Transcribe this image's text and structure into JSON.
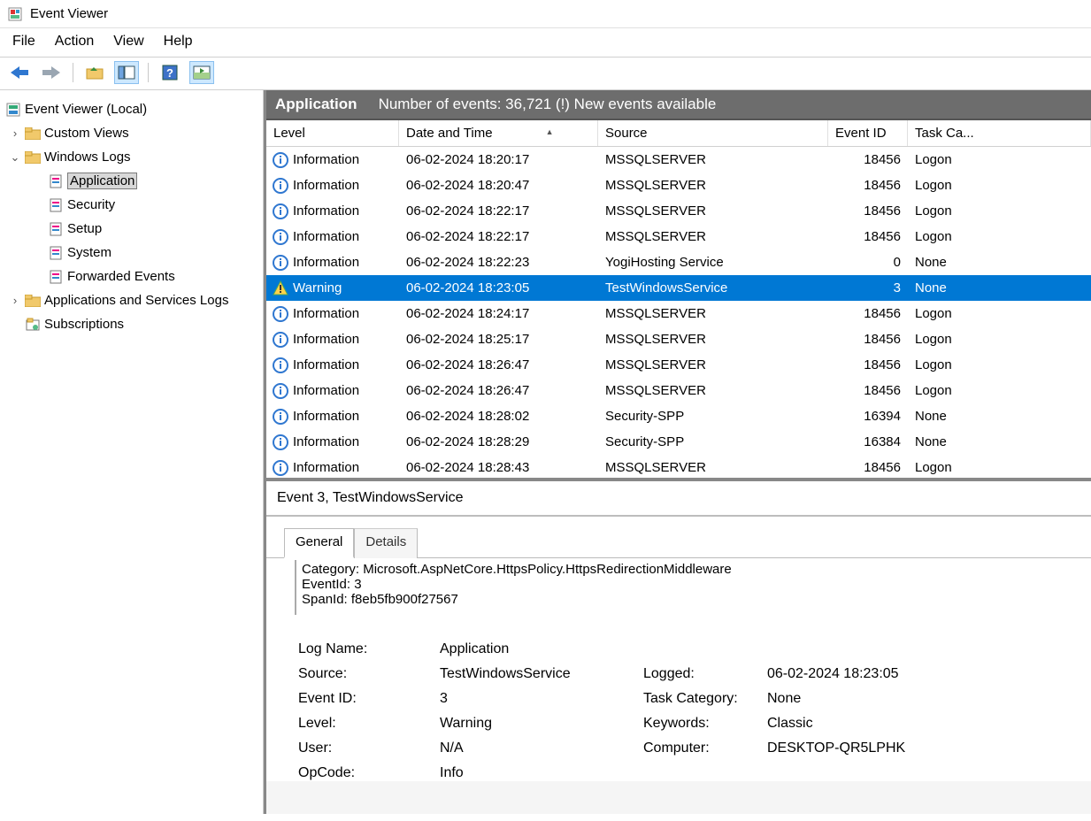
{
  "window": {
    "title": "Event Viewer"
  },
  "menubar": [
    "File",
    "Action",
    "View",
    "Help"
  ],
  "tree": {
    "root": "Event Viewer (Local)",
    "items": [
      {
        "label": "Custom Views",
        "expand": ">"
      },
      {
        "label": "Windows Logs",
        "expand": "v",
        "children": [
          {
            "label": "Application",
            "selected": true
          },
          {
            "label": "Security"
          },
          {
            "label": "Setup"
          },
          {
            "label": "System"
          },
          {
            "label": "Forwarded Events"
          }
        ]
      },
      {
        "label": "Applications and Services Logs",
        "expand": ">"
      },
      {
        "label": "Subscriptions"
      }
    ]
  },
  "header": {
    "title": "Application",
    "status": "Number of events: 36,721 (!) New events available"
  },
  "columns": [
    "Level",
    "Date and Time",
    "Source",
    "Event ID",
    "Task Ca..."
  ],
  "events": [
    {
      "level": "Information",
      "date": "06-02-2024 18:20:17",
      "source": "MSSQLSERVER",
      "eid": "18456",
      "task": "Logon"
    },
    {
      "level": "Information",
      "date": "06-02-2024 18:20:47",
      "source": "MSSQLSERVER",
      "eid": "18456",
      "task": "Logon"
    },
    {
      "level": "Information",
      "date": "06-02-2024 18:22:17",
      "source": "MSSQLSERVER",
      "eid": "18456",
      "task": "Logon"
    },
    {
      "level": "Information",
      "date": "06-02-2024 18:22:17",
      "source": "MSSQLSERVER",
      "eid": "18456",
      "task": "Logon"
    },
    {
      "level": "Information",
      "date": "06-02-2024 18:22:23",
      "source": "YogiHosting Service",
      "eid": "0",
      "task": "None"
    },
    {
      "level": "Warning",
      "date": "06-02-2024 18:23:05",
      "source": "TestWindowsService",
      "eid": "3",
      "task": "None",
      "selected": true
    },
    {
      "level": "Information",
      "date": "06-02-2024 18:24:17",
      "source": "MSSQLSERVER",
      "eid": "18456",
      "task": "Logon"
    },
    {
      "level": "Information",
      "date": "06-02-2024 18:25:17",
      "source": "MSSQLSERVER",
      "eid": "18456",
      "task": "Logon"
    },
    {
      "level": "Information",
      "date": "06-02-2024 18:26:47",
      "source": "MSSQLSERVER",
      "eid": "18456",
      "task": "Logon"
    },
    {
      "level": "Information",
      "date": "06-02-2024 18:26:47",
      "source": "MSSQLSERVER",
      "eid": "18456",
      "task": "Logon"
    },
    {
      "level": "Information",
      "date": "06-02-2024 18:28:02",
      "source": "Security-SPP",
      "eid": "16394",
      "task": "None"
    },
    {
      "level": "Information",
      "date": "06-02-2024 18:28:29",
      "source": "Security-SPP",
      "eid": "16384",
      "task": "None"
    },
    {
      "level": "Information",
      "date": "06-02-2024 18:28:43",
      "source": "MSSQLSERVER",
      "eid": "18456",
      "task": "Logon"
    }
  ],
  "detail": {
    "title": "Event 3, TestWindowsService",
    "tabs": {
      "general": "General",
      "details": "Details"
    },
    "message": [
      "Category: Microsoft.AspNetCore.HttpsPolicy.HttpsRedirectionMiddleware",
      "EventId: 3",
      "SpanId: f8eb5fb900f27567"
    ],
    "props": {
      "log_name_l": "Log Name:",
      "log_name_v": "Application",
      "source_l": "Source:",
      "source_v": "TestWindowsService",
      "logged_l": "Logged:",
      "logged_v": "06-02-2024 18:23:05",
      "eid_l": "Event ID:",
      "eid_v": "3",
      "taskc_l": "Task Category:",
      "taskc_v": "None",
      "level_l": "Level:",
      "level_v": "Warning",
      "keyw_l": "Keywords:",
      "keyw_v": "Classic",
      "user_l": "User:",
      "user_v": "N/A",
      "comp_l": "Computer:",
      "comp_v": "DESKTOP-QR5LPHK",
      "op_l": "OpCode:",
      "op_v": "Info"
    }
  }
}
